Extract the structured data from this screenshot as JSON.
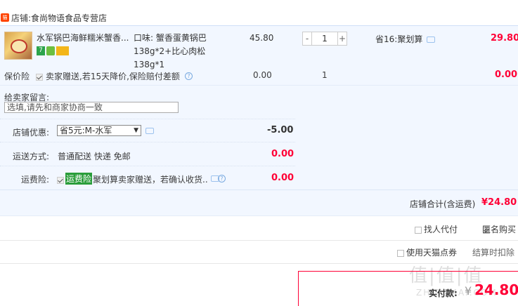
{
  "shop": {
    "prefix": "店铺:",
    "name": "食尚物语食品专营店",
    "logo_text": "天猫"
  },
  "item": {
    "title": "水军锅巴海鲜糯米蟹香...",
    "sku_label": "口味:",
    "sku_value": "蟹香蛋黄锅巴 138g*2+比心肉松138g*1",
    "price": "45.80",
    "qty": "1",
    "minus": "-",
    "plus": "+",
    "promo": "省16:聚划算",
    "subtotal": "29.80",
    "badges": [
      "7",
      "",
      ""
    ]
  },
  "insurance": {
    "label": "保价险",
    "desc": "卖家赠送,若15天降价,保险赔付差额",
    "price": "0.00",
    "qty": "1",
    "amount": "0.00"
  },
  "message": {
    "label": "给卖家留言:",
    "placeholder": "选填,请先和商家协商一致"
  },
  "coupon": {
    "label": "店铺优惠:",
    "selected": "省5元:M-水军",
    "amount": "-5.00"
  },
  "shipping": {
    "label": "运送方式:",
    "method": "普通配送 快递 免邮",
    "amount": "0.00"
  },
  "freight_ins": {
    "label": "运费险:",
    "tag": "运费险",
    "desc": "聚划算卖家赠送，若确认收货..",
    "amount": "0.00"
  },
  "shop_total": {
    "label": "店铺合计(含运费)",
    "amount": "¥24.80"
  },
  "options": {
    "proxy_pay": "找人代付",
    "anonymous": "匿名购买",
    "tmall_points": "使用天猫点券",
    "settle_note": "结算时扣除"
  },
  "payment": {
    "label": "实付款:",
    "currency": "¥",
    "amount": "24.80"
  },
  "watermark": {
    "main": "值|值|值",
    "sub": "ZHIDEMAI.COM"
  },
  "colors": {
    "accent_red": "#ff0036",
    "panel_blue": "#f2f7ff"
  }
}
